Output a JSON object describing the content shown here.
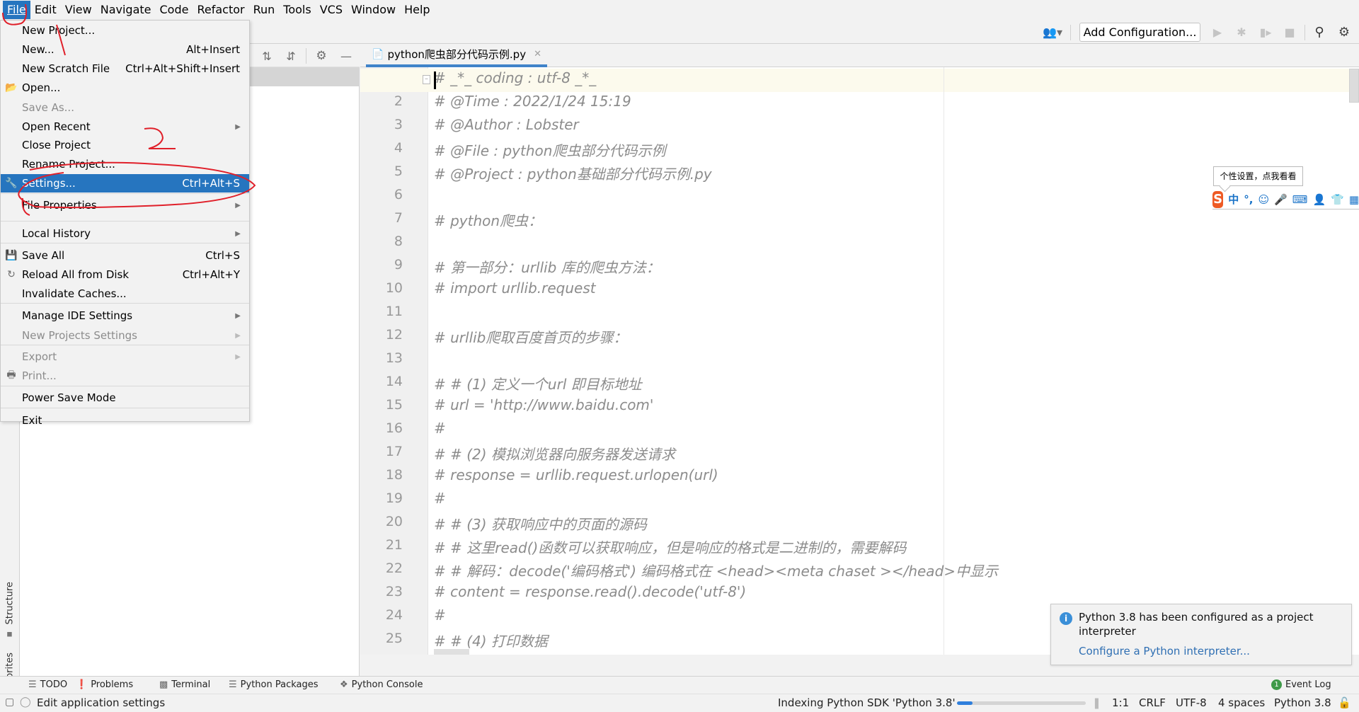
{
  "menubar": {
    "items": [
      {
        "label": "File",
        "active": true
      },
      {
        "label": "Edit"
      },
      {
        "label": "View"
      },
      {
        "label": "Navigate"
      },
      {
        "label": "Code"
      },
      {
        "label": "Refactor"
      },
      {
        "label": "Run"
      },
      {
        "label": "Tools"
      },
      {
        "label": "VCS"
      },
      {
        "label": "Window"
      },
      {
        "label": "Help"
      }
    ]
  },
  "toolbar": {
    "add_configuration": "Add Configuration...",
    "icons": [
      "user-icon",
      "run-icon",
      "debug-icon",
      "coverage-icon",
      "stop-icon",
      "search-icon",
      "settings-icon"
    ]
  },
  "file_menu": {
    "items": [
      {
        "label": "New Project...",
        "shortcut": ""
      },
      {
        "label": "New...",
        "shortcut": "Alt+Insert"
      },
      {
        "label": "New Scratch File",
        "shortcut": "Ctrl+Alt+Shift+Insert"
      },
      {
        "label": "Open...",
        "shortcut": "",
        "icon": "folder-icon"
      },
      {
        "label": "Save As...",
        "shortcut": "",
        "disabled": true
      },
      {
        "label": "Open Recent",
        "submenu": true
      },
      {
        "label": "Close Project",
        "shortcut": ""
      },
      {
        "label": "Rename Project...",
        "shortcut": ""
      },
      {
        "label": "Settings...",
        "shortcut": "Ctrl+Alt+S",
        "icon": "wrench-icon",
        "selected": true
      },
      {
        "label": "File Properties",
        "submenu": true
      },
      {
        "label": "Local History",
        "submenu": true
      },
      {
        "label": "Save All",
        "shortcut": "Ctrl+S",
        "icon": "save-icon"
      },
      {
        "label": "Reload All from Disk",
        "shortcut": "Ctrl+Alt+Y",
        "icon": "reload-icon"
      },
      {
        "label": "Invalidate Caches...",
        "shortcut": ""
      },
      {
        "label": "Manage IDE Settings",
        "submenu": true
      },
      {
        "label": "New Projects Settings",
        "submenu": true,
        "disabled": true
      },
      {
        "label": "Export",
        "submenu": true,
        "disabled": true
      },
      {
        "label": "Print...",
        "icon": "print-icon",
        "disabled": true
      },
      {
        "label": "Power Save Mode",
        "shortcut": ""
      },
      {
        "label": "Exit",
        "shortcut": ""
      }
    ]
  },
  "editor": {
    "tab": {
      "label": "python爬虫部分代码示例.py",
      "icon": "python-file-icon"
    },
    "lines": [
      "# _*_ coding : utf-8 _*_",
      "# @Time : 2022/1/24 15:19",
      "# @Author : Lobster",
      "# @File : python爬虫部分代码示例",
      "# @Project : python基础部分代码示例.py",
      "",
      "# python爬虫：",
      "",
      "# 第一部分：urllib 库的爬虫方法：",
      "# import urllib.request",
      "",
      "# urllib爬取百度首页的步骤：",
      "",
      "# # (1) 定义一个url  即目标地址",
      "# url = 'http://www.baidu.com'",
      "#",
      "# # (2) 模拟浏览器向服务器发送请求",
      "# response = urllib.request.urlopen(url)",
      "#",
      "# # (3) 获取响应中的页面的源码",
      "# # 这里read()函数可以获取响应，但是响应的格式是二进制的，需要解码",
      "# # 解码：decode('编码格式')  编码格式在 <head><meta chaset ></head>中显示",
      "# content = response.read().decode('utf-8')",
      "#",
      "# # (4) 打印数据"
    ]
  },
  "left_stripe": {
    "structure": "Structure",
    "favorites": "Favorites"
  },
  "ime": {
    "tooltip": "个性设置，点我看看",
    "logo": "S",
    "mode": "中",
    "punct": "°,"
  },
  "notification": {
    "message": "Python 3.8 has been configured as a project interpreter",
    "link": "Configure a Python interpreter..."
  },
  "bottom_tools": {
    "todo": "TODO",
    "problems": "Problems",
    "terminal": "Terminal",
    "python_packages": "Python Packages",
    "python_console": "Python Console",
    "event_log": "Event Log",
    "event_log_count": "1"
  },
  "statusbar": {
    "hint": "Edit application settings",
    "indexing": "Indexing Python SDK 'Python 3.8'",
    "indexing_progress": 0.12,
    "position": "1:1",
    "line_sep": "CRLF",
    "encoding": "UTF-8",
    "indent": "4 spaces",
    "interpreter": "Python 3.8"
  }
}
